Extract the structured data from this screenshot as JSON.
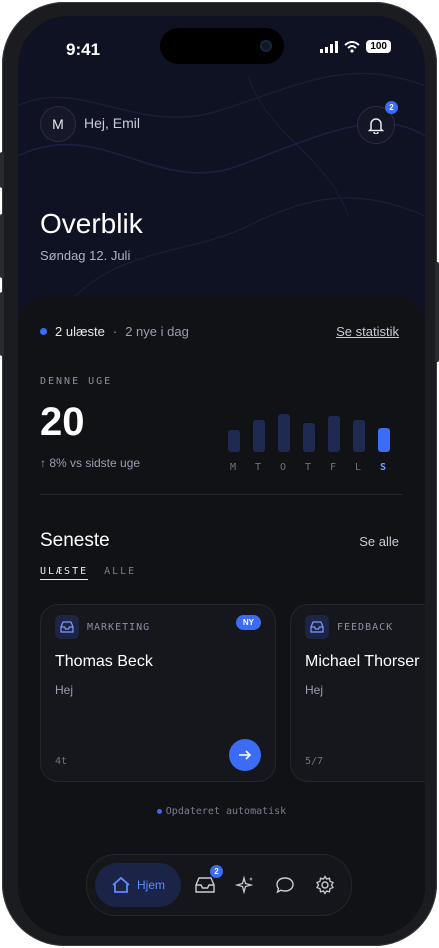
{
  "status_bar": {
    "time": "9:41",
    "battery": "100"
  },
  "header": {
    "avatar_initial": "M",
    "greeting": "Hej, Emil",
    "notification_count": "2"
  },
  "page": {
    "title": "Overblik",
    "date": "Søndag 12. Juli"
  },
  "summary": {
    "unread": "2 ulæste",
    "separator": "·",
    "new_today": "2 nye i dag",
    "stats_link": "Se statistik"
  },
  "week": {
    "label": "DENNE UGE",
    "total": "20",
    "trend": "↑ 8% vs sidste uge",
    "days": [
      "M",
      "T",
      "O",
      "T",
      "F",
      "L",
      "S"
    ],
    "levels": [
      0.55,
      0.8,
      0.95,
      0.72,
      0.9,
      0.8,
      0.6
    ],
    "active_index": 6
  },
  "recent": {
    "title": "Seneste",
    "see_all": "Se alle",
    "tabs": [
      "ULÆSTE",
      "ALLE"
    ],
    "cards": [
      {
        "tag": "MARKETING",
        "name": "Thomas Beck",
        "message": "Hej",
        "time": "4t",
        "badge": "NY"
      },
      {
        "tag": "FEEDBACK",
        "name": "Michael Thorser",
        "message": "Hej",
        "time": "5/7"
      }
    ],
    "updated": "Opdateret automatisk"
  },
  "nav": {
    "home_label": "Hjem",
    "inbox_badge": "2"
  },
  "colors": {
    "accent": "#3b6cf6",
    "background": "#0f1222",
    "sheet": "#111216"
  }
}
